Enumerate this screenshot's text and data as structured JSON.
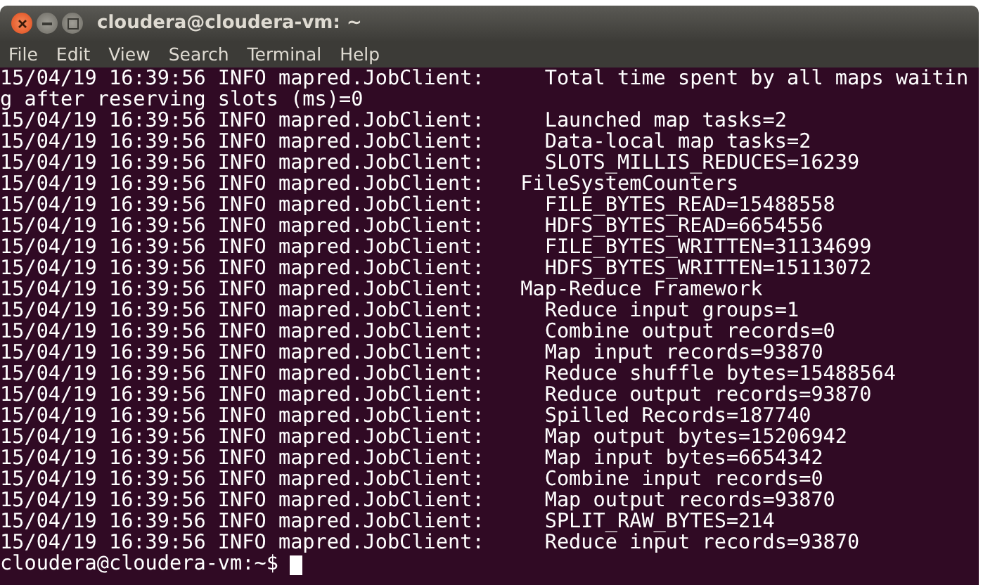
{
  "window": {
    "title": "cloudera@cloudera-vm: ~"
  },
  "menu": [
    "File",
    "Edit",
    "View",
    "Search",
    "Terminal",
    "Help"
  ],
  "terminal": {
    "lines": [
      "15/04/19 16:39:56 INFO mapred.JobClient:     Total time spent by all maps waitin",
      "g after reserving slots (ms)=0",
      "15/04/19 16:39:56 INFO mapred.JobClient:     Launched map tasks=2",
      "15/04/19 16:39:56 INFO mapred.JobClient:     Data-local map tasks=2",
      "15/04/19 16:39:56 INFO mapred.JobClient:     SLOTS_MILLIS_REDUCES=16239",
      "15/04/19 16:39:56 INFO mapred.JobClient:   FileSystemCounters",
      "15/04/19 16:39:56 INFO mapred.JobClient:     FILE_BYTES_READ=15488558",
      "15/04/19 16:39:56 INFO mapred.JobClient:     HDFS_BYTES_READ=6654556",
      "15/04/19 16:39:56 INFO mapred.JobClient:     FILE_BYTES_WRITTEN=31134699",
      "15/04/19 16:39:56 INFO mapred.JobClient:     HDFS_BYTES_WRITTEN=15113072",
      "15/04/19 16:39:56 INFO mapred.JobClient:   Map-Reduce Framework",
      "15/04/19 16:39:56 INFO mapred.JobClient:     Reduce input groups=1",
      "15/04/19 16:39:56 INFO mapred.JobClient:     Combine output records=0",
      "15/04/19 16:39:56 INFO mapred.JobClient:     Map input records=93870",
      "15/04/19 16:39:56 INFO mapred.JobClient:     Reduce shuffle bytes=15488564",
      "15/04/19 16:39:56 INFO mapred.JobClient:     Reduce output records=93870",
      "15/04/19 16:39:56 INFO mapred.JobClient:     Spilled Records=187740",
      "15/04/19 16:39:56 INFO mapred.JobClient:     Map output bytes=15206942",
      "15/04/19 16:39:56 INFO mapred.JobClient:     Map input bytes=6654342",
      "15/04/19 16:39:56 INFO mapred.JobClient:     Combine input records=0",
      "15/04/19 16:39:56 INFO mapred.JobClient:     Map output records=93870",
      "15/04/19 16:39:56 INFO mapred.JobClient:     SPLIT_RAW_BYTES=214",
      "15/04/19 16:39:56 INFO mapred.JobClient:     Reduce input records=93870"
    ],
    "prompt": "cloudera@cloudera-vm:~$"
  }
}
